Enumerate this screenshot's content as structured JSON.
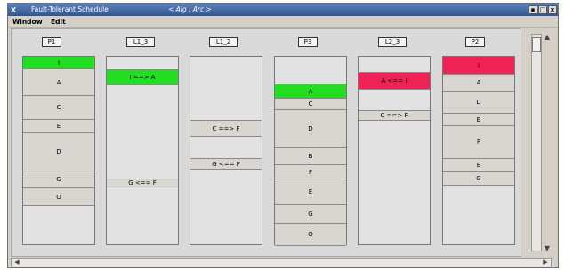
{
  "window": {
    "logo": "X",
    "title": "Fault-Tolerant Schedule",
    "subtitle": "< Alg , Arc >",
    "minimize": "▪",
    "maximize": "□",
    "close": "x"
  },
  "menu": [
    "Window",
    "Edit"
  ],
  "columns": [
    {
      "label": "P1",
      "blocks": [
        {
          "text": "I",
          "color": "#22dd22"
        },
        {
          "text": "A"
        },
        {
          "text": "C"
        },
        {
          "text": "E"
        },
        {
          "text": "D"
        },
        {
          "text": "G"
        },
        {
          "text": "O"
        }
      ]
    },
    {
      "label": "L1_3",
      "blocks": [
        {
          "text": "I ==> A",
          "color": "#22dd22"
        },
        {
          "text": "G <== F"
        }
      ]
    },
    {
      "label": "L1_2",
      "blocks": [
        {
          "text": "C ==> F"
        },
        {
          "text": "G <== F"
        }
      ]
    },
    {
      "label": "P3",
      "blocks": [
        {
          "text": "A",
          "color": "#22dd22"
        },
        {
          "text": "C"
        },
        {
          "text": "D"
        },
        {
          "text": "B"
        },
        {
          "text": "F"
        },
        {
          "text": "E"
        },
        {
          "text": "G"
        },
        {
          "text": "O"
        }
      ]
    },
    {
      "label": "L2_3",
      "blocks": [
        {
          "text": "A <== I",
          "color": "#ee2255"
        },
        {
          "text": "C ==> F"
        }
      ]
    },
    {
      "label": "P2",
      "blocks": [
        {
          "text": "I",
          "color": "#ee2255"
        },
        {
          "text": "A"
        },
        {
          "text": "D"
        },
        {
          "text": "B"
        },
        {
          "text": "F"
        },
        {
          "text": "E"
        },
        {
          "text": "G"
        }
      ]
    }
  ],
  "scroll": {
    "up": "▲",
    "down": "▼",
    "left": "◀",
    "right": "▶"
  }
}
